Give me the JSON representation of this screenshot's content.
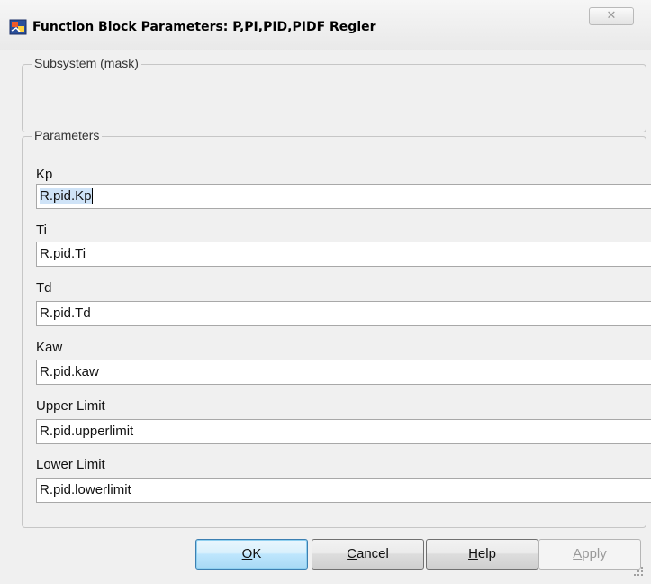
{
  "window": {
    "title": "Function Block Parameters: P,PI,PID,PIDF Regler",
    "close_glyph": "✕",
    "icon": "simulink-block-icon"
  },
  "subsystem_group": {
    "legend": "Subsystem (mask)"
  },
  "parameters_group": {
    "legend": "Parameters",
    "fields": [
      {
        "label": "Kp",
        "value": "R.pid.Kp"
      },
      {
        "label": "Ti",
        "value": "R.pid.Ti"
      },
      {
        "label": "Td",
        "value": "R.pid.Td"
      },
      {
        "label": "Kaw",
        "value": "R.pid.kaw"
      },
      {
        "label": "Upper Limit",
        "value": "R.pid.upperlimit"
      },
      {
        "label": "Lower Limit",
        "value": "R.pid.lowerlimit"
      }
    ]
  },
  "buttons": {
    "ok": {
      "mnemonic": "O",
      "rest": "K"
    },
    "cancel": {
      "mnemonic": "C",
      "rest": "ancel"
    },
    "help": {
      "mnemonic": "H",
      "rest": "elp"
    },
    "apply": {
      "mnemonic": "A",
      "rest": "pply",
      "enabled": false
    }
  },
  "colors": {
    "default_button_border": "#3c7fb1",
    "selection": "#cfe3f7"
  }
}
